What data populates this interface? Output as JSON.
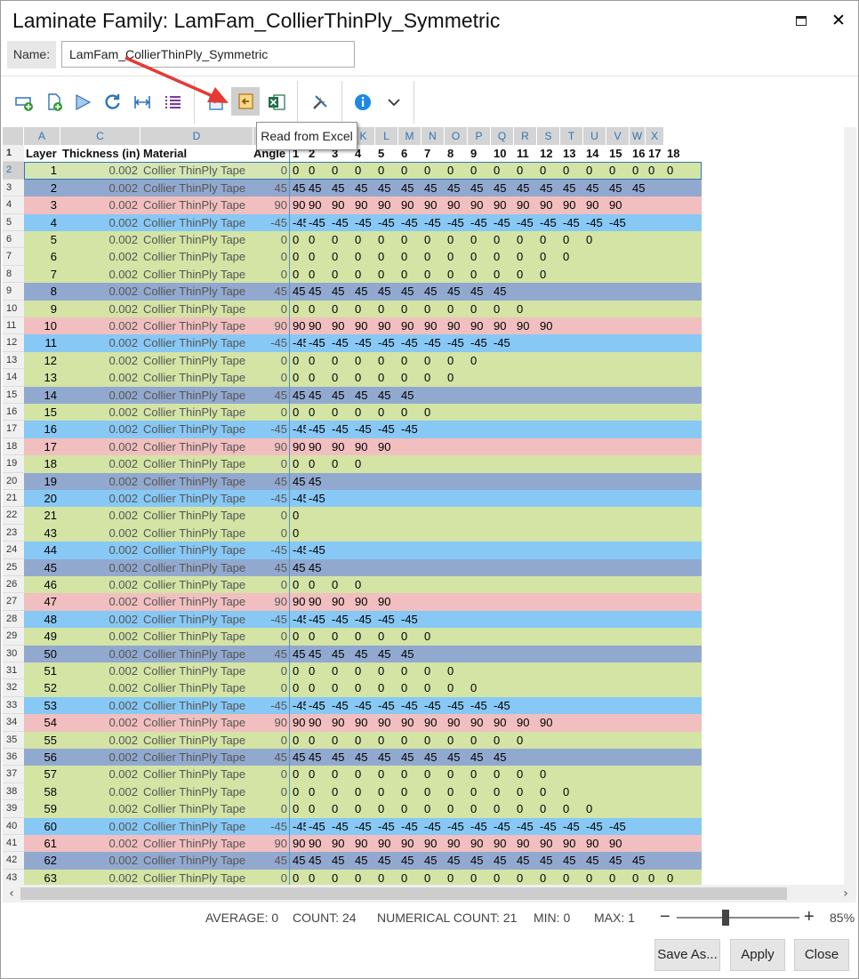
{
  "window": {
    "title": "Laminate Family: LamFam_CollierThinPly_Symmetric",
    "maximize_icon": "maximize-icon",
    "close_glyph": "✕"
  },
  "name_field": {
    "label": "Name:",
    "value": "LamFam_CollierThinPly_Symmetric"
  },
  "toolbar": {
    "tooltip": "Read from Excel"
  },
  "grid": {
    "col_letters": [
      "A",
      "C",
      "D",
      "G",
      "H",
      "I",
      "J",
      "K",
      "L",
      "M",
      "N",
      "O",
      "P",
      "Q",
      "R",
      "S",
      "T",
      "U",
      "V",
      "W",
      "X"
    ],
    "headers": {
      "layer": "Layer",
      "thickness": "Thickness (in)",
      "material": "Material",
      "angle": "Angle",
      "seq": [
        "1",
        "2",
        "3",
        "4",
        "5",
        "6",
        "7",
        "8",
        "9",
        "10",
        "11",
        "12",
        "13",
        "14",
        "15",
        "16",
        "17",
        "18"
      ]
    },
    "rows": [
      {
        "rn": "2",
        "layer": "1",
        "thick": "0.002",
        "mat": "Collier ThinPly Tape",
        "angle": "0",
        "vals": [
          "0",
          "0",
          "0",
          "0",
          "0",
          "0",
          "0",
          "0",
          "0",
          "0",
          "0",
          "0",
          "0",
          "0",
          "0",
          "0",
          "0",
          "0"
        ]
      },
      {
        "rn": "3",
        "layer": "2",
        "thick": "0.002",
        "mat": "Collier ThinPly Tape",
        "angle": "45",
        "vals": [
          "45",
          "45",
          "45",
          "45",
          "45",
          "45",
          "45",
          "45",
          "45",
          "45",
          "45",
          "45",
          "45",
          "45",
          "45",
          "45"
        ]
      },
      {
        "rn": "4",
        "layer": "3",
        "thick": "0.002",
        "mat": "Collier ThinPly Tape",
        "angle": "90",
        "vals": [
          "90",
          "90",
          "90",
          "90",
          "90",
          "90",
          "90",
          "90",
          "90",
          "90",
          "90",
          "90",
          "90",
          "90",
          "90"
        ]
      },
      {
        "rn": "5",
        "layer": "4",
        "thick": "0.002",
        "mat": "Collier ThinPly Tape",
        "angle": "-45",
        "vals": [
          "-45",
          "-45",
          "-45",
          "-45",
          "-45",
          "-45",
          "-45",
          "-45",
          "-45",
          "-45",
          "-45",
          "-45",
          "-45",
          "-45",
          "-45"
        ]
      },
      {
        "rn": "6",
        "layer": "5",
        "thick": "0.002",
        "mat": "Collier ThinPly Tape",
        "angle": "0",
        "vals": [
          "0",
          "0",
          "0",
          "0",
          "0",
          "0",
          "0",
          "0",
          "0",
          "0",
          "0",
          "0",
          "0",
          "0"
        ]
      },
      {
        "rn": "7",
        "layer": "6",
        "thick": "0.002",
        "mat": "Collier ThinPly Tape",
        "angle": "0",
        "vals": [
          "0",
          "0",
          "0",
          "0",
          "0",
          "0",
          "0",
          "0",
          "0",
          "0",
          "0",
          "0",
          "0"
        ]
      },
      {
        "rn": "8",
        "layer": "7",
        "thick": "0.002",
        "mat": "Collier ThinPly Tape",
        "angle": "0",
        "vals": [
          "0",
          "0",
          "0",
          "0",
          "0",
          "0",
          "0",
          "0",
          "0",
          "0",
          "0",
          "0"
        ]
      },
      {
        "rn": "9",
        "layer": "8",
        "thick": "0.002",
        "mat": "Collier ThinPly Tape",
        "angle": "45",
        "vals": [
          "45",
          "45",
          "45",
          "45",
          "45",
          "45",
          "45",
          "45",
          "45",
          "45"
        ]
      },
      {
        "rn": "10",
        "layer": "9",
        "thick": "0.002",
        "mat": "Collier ThinPly Tape",
        "angle": "0",
        "vals": [
          "0",
          "0",
          "0",
          "0",
          "0",
          "0",
          "0",
          "0",
          "0",
          "0",
          "0"
        ]
      },
      {
        "rn": "11",
        "layer": "10",
        "thick": "0.002",
        "mat": "Collier ThinPly Tape",
        "angle": "90",
        "vals": [
          "90",
          "90",
          "90",
          "90",
          "90",
          "90",
          "90",
          "90",
          "90",
          "90",
          "90",
          "90"
        ]
      },
      {
        "rn": "12",
        "layer": "11",
        "thick": "0.002",
        "mat": "Collier ThinPly Tape",
        "angle": "-45",
        "vals": [
          "-45",
          "-45",
          "-45",
          "-45",
          "-45",
          "-45",
          "-45",
          "-45",
          "-45",
          "-45"
        ]
      },
      {
        "rn": "13",
        "layer": "12",
        "thick": "0.002",
        "mat": "Collier ThinPly Tape",
        "angle": "0",
        "vals": [
          "0",
          "0",
          "0",
          "0",
          "0",
          "0",
          "0",
          "0",
          "0"
        ]
      },
      {
        "rn": "14",
        "layer": "13",
        "thick": "0.002",
        "mat": "Collier ThinPly Tape",
        "angle": "0",
        "vals": [
          "0",
          "0",
          "0",
          "0",
          "0",
          "0",
          "0",
          "0"
        ]
      },
      {
        "rn": "15",
        "layer": "14",
        "thick": "0.002",
        "mat": "Collier ThinPly Tape",
        "angle": "45",
        "vals": [
          "45",
          "45",
          "45",
          "45",
          "45",
          "45"
        ]
      },
      {
        "rn": "16",
        "layer": "15",
        "thick": "0.002",
        "mat": "Collier ThinPly Tape",
        "angle": "0",
        "vals": [
          "0",
          "0",
          "0",
          "0",
          "0",
          "0",
          "0"
        ]
      },
      {
        "rn": "17",
        "layer": "16",
        "thick": "0.002",
        "mat": "Collier ThinPly Tape",
        "angle": "-45",
        "vals": [
          "-45",
          "-45",
          "-45",
          "-45",
          "-45",
          "-45"
        ]
      },
      {
        "rn": "18",
        "layer": "17",
        "thick": "0.002",
        "mat": "Collier ThinPly Tape",
        "angle": "90",
        "vals": [
          "90",
          "90",
          "90",
          "90",
          "90"
        ]
      },
      {
        "rn": "19",
        "layer": "18",
        "thick": "0.002",
        "mat": "Collier ThinPly Tape",
        "angle": "0",
        "vals": [
          "0",
          "0",
          "0",
          "0"
        ]
      },
      {
        "rn": "20",
        "layer": "19",
        "thick": "0.002",
        "mat": "Collier ThinPly Tape",
        "angle": "45",
        "vals": [
          "45",
          "45"
        ]
      },
      {
        "rn": "21",
        "layer": "20",
        "thick": "0.002",
        "mat": "Collier ThinPly Tape",
        "angle": "-45",
        "vals": [
          "-45",
          "-45"
        ]
      },
      {
        "rn": "22",
        "layer": "21",
        "thick": "0.002",
        "mat": "Collier ThinPly Tape",
        "angle": "0",
        "vals": [
          "0"
        ]
      },
      {
        "rn": "23",
        "layer": "43",
        "thick": "0.002",
        "mat": "Collier ThinPly Tape",
        "angle": "0",
        "vals": [
          "0"
        ]
      },
      {
        "rn": "24",
        "layer": "44",
        "thick": "0.002",
        "mat": "Collier ThinPly Tape",
        "angle": "-45",
        "vals": [
          "-45",
          "-45"
        ]
      },
      {
        "rn": "25",
        "layer": "45",
        "thick": "0.002",
        "mat": "Collier ThinPly Tape",
        "angle": "45",
        "vals": [
          "45",
          "45"
        ]
      },
      {
        "rn": "26",
        "layer": "46",
        "thick": "0.002",
        "mat": "Collier ThinPly Tape",
        "angle": "0",
        "vals": [
          "0",
          "0",
          "0",
          "0"
        ]
      },
      {
        "rn": "27",
        "layer": "47",
        "thick": "0.002",
        "mat": "Collier ThinPly Tape",
        "angle": "90",
        "vals": [
          "90",
          "90",
          "90",
          "90",
          "90"
        ]
      },
      {
        "rn": "28",
        "layer": "48",
        "thick": "0.002",
        "mat": "Collier ThinPly Tape",
        "angle": "-45",
        "vals": [
          "-45",
          "-45",
          "-45",
          "-45",
          "-45",
          "-45"
        ]
      },
      {
        "rn": "29",
        "layer": "49",
        "thick": "0.002",
        "mat": "Collier ThinPly Tape",
        "angle": "0",
        "vals": [
          "0",
          "0",
          "0",
          "0",
          "0",
          "0",
          "0"
        ]
      },
      {
        "rn": "30",
        "layer": "50",
        "thick": "0.002",
        "mat": "Collier ThinPly Tape",
        "angle": "45",
        "vals": [
          "45",
          "45",
          "45",
          "45",
          "45",
          "45"
        ]
      },
      {
        "rn": "31",
        "layer": "51",
        "thick": "0.002",
        "mat": "Collier ThinPly Tape",
        "angle": "0",
        "vals": [
          "0",
          "0",
          "0",
          "0",
          "0",
          "0",
          "0",
          "0"
        ]
      },
      {
        "rn": "32",
        "layer": "52",
        "thick": "0.002",
        "mat": "Collier ThinPly Tape",
        "angle": "0",
        "vals": [
          "0",
          "0",
          "0",
          "0",
          "0",
          "0",
          "0",
          "0",
          "0"
        ]
      },
      {
        "rn": "33",
        "layer": "53",
        "thick": "0.002",
        "mat": "Collier ThinPly Tape",
        "angle": "-45",
        "vals": [
          "-45",
          "-45",
          "-45",
          "-45",
          "-45",
          "-45",
          "-45",
          "-45",
          "-45",
          "-45"
        ]
      },
      {
        "rn": "34",
        "layer": "54",
        "thick": "0.002",
        "mat": "Collier ThinPly Tape",
        "angle": "90",
        "vals": [
          "90",
          "90",
          "90",
          "90",
          "90",
          "90",
          "90",
          "90",
          "90",
          "90",
          "90",
          "90"
        ]
      },
      {
        "rn": "35",
        "layer": "55",
        "thick": "0.002",
        "mat": "Collier ThinPly Tape",
        "angle": "0",
        "vals": [
          "0",
          "0",
          "0",
          "0",
          "0",
          "0",
          "0",
          "0",
          "0",
          "0",
          "0"
        ]
      },
      {
        "rn": "36",
        "layer": "56",
        "thick": "0.002",
        "mat": "Collier ThinPly Tape",
        "angle": "45",
        "vals": [
          "45",
          "45",
          "45",
          "45",
          "45",
          "45",
          "45",
          "45",
          "45",
          "45"
        ]
      },
      {
        "rn": "37",
        "layer": "57",
        "thick": "0.002",
        "mat": "Collier ThinPly Tape",
        "angle": "0",
        "vals": [
          "0",
          "0",
          "0",
          "0",
          "0",
          "0",
          "0",
          "0",
          "0",
          "0",
          "0",
          "0"
        ]
      },
      {
        "rn": "38",
        "layer": "58",
        "thick": "0.002",
        "mat": "Collier ThinPly Tape",
        "angle": "0",
        "vals": [
          "0",
          "0",
          "0",
          "0",
          "0",
          "0",
          "0",
          "0",
          "0",
          "0",
          "0",
          "0",
          "0"
        ]
      },
      {
        "rn": "39",
        "layer": "59",
        "thick": "0.002",
        "mat": "Collier ThinPly Tape",
        "angle": "0",
        "vals": [
          "0",
          "0",
          "0",
          "0",
          "0",
          "0",
          "0",
          "0",
          "0",
          "0",
          "0",
          "0",
          "0",
          "0"
        ]
      },
      {
        "rn": "40",
        "layer": "60",
        "thick": "0.002",
        "mat": "Collier ThinPly Tape",
        "angle": "-45",
        "vals": [
          "-45",
          "-45",
          "-45",
          "-45",
          "-45",
          "-45",
          "-45",
          "-45",
          "-45",
          "-45",
          "-45",
          "-45",
          "-45",
          "-45",
          "-45"
        ]
      },
      {
        "rn": "41",
        "layer": "61",
        "thick": "0.002",
        "mat": "Collier ThinPly Tape",
        "angle": "90",
        "vals": [
          "90",
          "90",
          "90",
          "90",
          "90",
          "90",
          "90",
          "90",
          "90",
          "90",
          "90",
          "90",
          "90",
          "90",
          "90"
        ]
      },
      {
        "rn": "42",
        "layer": "62",
        "thick": "0.002",
        "mat": "Collier ThinPly Tape",
        "angle": "45",
        "vals": [
          "45",
          "45",
          "45",
          "45",
          "45",
          "45",
          "45",
          "45",
          "45",
          "45",
          "45",
          "45",
          "45",
          "45",
          "45",
          "45"
        ]
      },
      {
        "rn": "43",
        "layer": "63",
        "thick": "0.002",
        "mat": "Collier ThinPly Tape",
        "angle": "0",
        "vals": [
          "0",
          "0",
          "0",
          "0",
          "0",
          "0",
          "0",
          "0",
          "0",
          "0",
          "0",
          "0",
          "0",
          "0",
          "0",
          "0",
          "0",
          "0"
        ]
      }
    ],
    "angle_colors": {
      "0": "#d3e4a5",
      "45": "#92a9cf",
      "90": "#f1bfbf",
      "-45": "#87c8f5"
    }
  },
  "statusbar": {
    "average": "AVERAGE: 0",
    "count": "COUNT: 24",
    "numerical_count": "NUMERICAL COUNT: 21",
    "min": "MIN: 0",
    "max": "MAX: 1",
    "zoom": "85%",
    "zoom_level": 0.4
  },
  "footer": {
    "save_as": "Save As...",
    "apply": "Apply",
    "close": "Close"
  }
}
